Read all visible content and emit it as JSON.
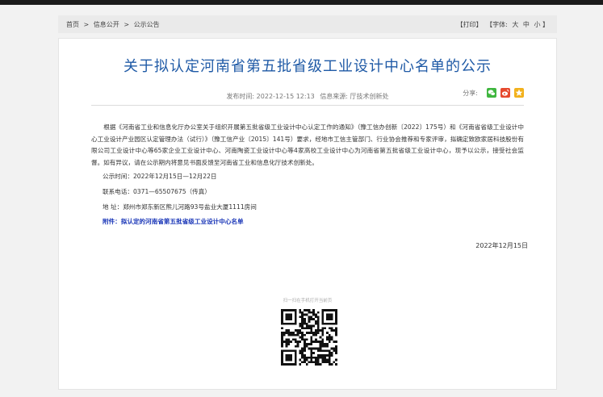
{
  "breadcrumb": {
    "home": "首页",
    "sep": ">",
    "section": "信息公开",
    "current": "公示公告"
  },
  "tools": {
    "print": "【打印】",
    "font_label": "【字体:",
    "large": "大",
    "medium": "中",
    "small": "小",
    "close": "】"
  },
  "article": {
    "title": "关于拟认定河南省第五批省级工业设计中心名单的公示",
    "publish_time": "发布时间: 2022-12-15 12:13",
    "source": "信息来源: 厅技术创新处",
    "share_label": "分享:",
    "paragraph": "根据《河南省工业和信息化厅办公室关于组织开展第五批省级工业设计中心认定工作的通知》（豫工信办创新〔2022〕175号）和《河南省省级工业设计中心工业设计产业园区认定管理办法（试行）》（豫工信产业〔2015〕141号）要求，经地市工信主管部门、行业协会推荐和专家评审，拟确定致欧家居科技股份有限公司工业设计中心等65家企业工业设计中心、河南陶瓷工业设计中心等4家高校工业设计中心为河南省第五批省级工业设计中心，现予以公示，接受社会监督。如有异议，请在公示期内将意见书面反馈至河南省工业和信息化厅技术创新处。",
    "period": "公示时间：2022年12月15日—12月22日",
    "phone": "联系电话：0371—65507675（传真）",
    "address": "地 址：郑州市郑东新区熊儿河路93号盐业大厦1111房间",
    "attachment": "附件：拟认定的河南省第五批省级工业设计中心名单",
    "date": "2022年12月15日",
    "qr_tip": "扫一扫在手机打开当前页"
  },
  "colors": {
    "title": "#1f5aa6",
    "attachment": "#1b37b8",
    "wechat": "#3fb63f",
    "weibo": "#e6492e",
    "qzone": "#f2b11c"
  },
  "icons": [
    "wechat-icon",
    "weibo-icon",
    "qzone-icon"
  ]
}
